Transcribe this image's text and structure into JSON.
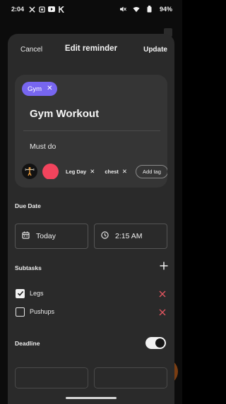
{
  "status_bar": {
    "time": "2:04",
    "notification_icons": [
      "x-logo-icon",
      "app-icon",
      "youtube-icon",
      "k-app-icon"
    ],
    "battery": "94%"
  },
  "header": {
    "cancel_label": "Cancel",
    "title": "Edit reminder",
    "update_label": "Update"
  },
  "reminder": {
    "category_chip": "Gym",
    "title": "Gym Workout",
    "description": "Must do",
    "color": "#f2445d",
    "tags": [
      "Leg Day",
      "chest"
    ],
    "add_tag_label": "Add tag"
  },
  "due_date": {
    "label": "Due Date",
    "date": "Today",
    "time": "2:15 AM"
  },
  "subtasks": {
    "label": "Subtasks",
    "items": [
      {
        "label": "Legs",
        "done": true
      },
      {
        "label": "Pushups",
        "done": false
      }
    ]
  },
  "deadline": {
    "label": "Deadline",
    "enabled": true
  },
  "colors": {
    "accent": "#7766f0",
    "remove": "#e0555f",
    "sheet": "#2a2a2a",
    "card": "#353535"
  }
}
